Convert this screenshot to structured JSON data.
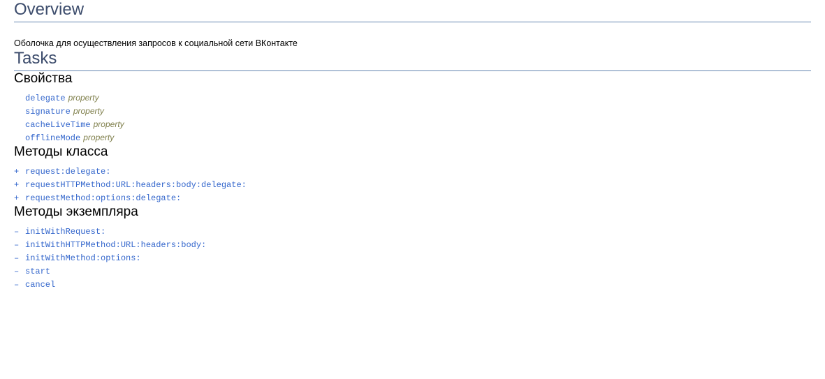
{
  "overview": {
    "title": "Overview",
    "text": "Оболочка для осуществления запросов к социальной сети ВКонтакте"
  },
  "tasks": {
    "title": "Tasks",
    "properties": {
      "title": "Свойства",
      "items": [
        {
          "name": "delegate",
          "kind": "property"
        },
        {
          "name": "signature",
          "kind": "property"
        },
        {
          "name": "cacheLiveTime",
          "kind": "property"
        },
        {
          "name": "offlineMode",
          "kind": "property"
        }
      ]
    },
    "class_methods": {
      "title": "Методы класса",
      "prefix": "+",
      "items": [
        {
          "name": "request:delegate:"
        },
        {
          "name": "requestHTTPMethod:URL:headers:body:delegate:"
        },
        {
          "name": "requestMethod:options:delegate:"
        }
      ]
    },
    "instance_methods": {
      "title": "Методы экземпляра",
      "prefix": "–",
      "items": [
        {
          "name": "initWithRequest:"
        },
        {
          "name": "initWithHTTPMethod:URL:headers:body:"
        },
        {
          "name": "initWithMethod:options:"
        },
        {
          "name": "start"
        },
        {
          "name": "cancel"
        }
      ]
    }
  }
}
